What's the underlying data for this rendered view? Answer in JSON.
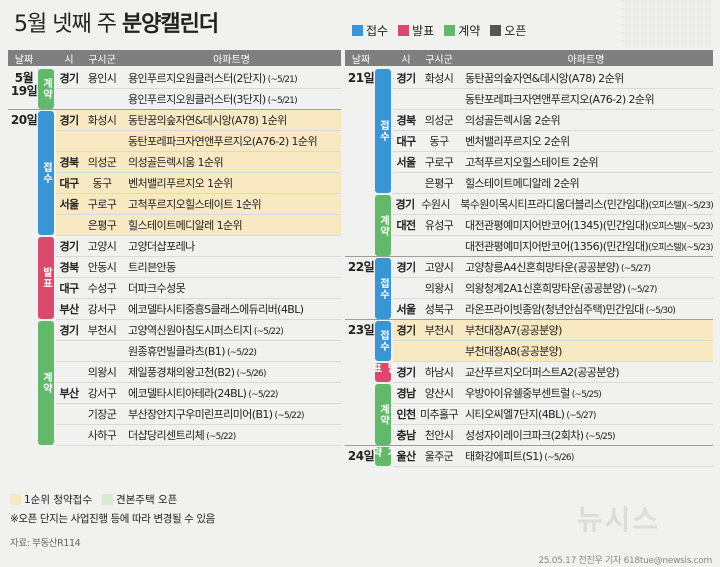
{
  "title": {
    "normal": "5월 넷째 주 ",
    "bold": "분양캘린더"
  },
  "legend": [
    {
      "label": "접수",
      "color": "#3a95d4"
    },
    {
      "label": "발표",
      "color": "#d94a6c"
    },
    {
      "label": "계약",
      "color": "#63b96b"
    },
    {
      "label": "오픈",
      "color": "#555555"
    }
  ],
  "headers": {
    "date": "날짜",
    "prov": "시",
    "city": "구시군",
    "apt": "아파트명"
  },
  "left_rows": [
    {
      "prov": "경기",
      "city": "용인시",
      "apt": "용인푸르지오원클러스터(2단지)",
      "note": " (~5/21)"
    },
    {
      "prov": "",
      "city": "",
      "apt": "용인푸르지오원클러스터(3단지)",
      "note": " (~5/21)"
    },
    {
      "prov": "경기",
      "city": "화성시",
      "apt": "동탄꿈의숲자연&데시앙(A78) 1순위",
      "note": ""
    },
    {
      "prov": "",
      "city": "",
      "apt": "동탄포레파크자연앤푸르지오(A76-2) 1순위",
      "note": ""
    },
    {
      "prov": "경북",
      "city": "의성군",
      "apt": "의성골든렉시움 1순위",
      "note": ""
    },
    {
      "prov": "대구",
      "city": "동구",
      "apt": "벤처밸리푸르지오 1순위",
      "note": ""
    },
    {
      "prov": "서울",
      "city": "구로구",
      "apt": "고척푸르지오힐스테이트 1순위",
      "note": ""
    },
    {
      "prov": "",
      "city": "은평구",
      "apt": "힐스테이트메디알레 1순위",
      "note": ""
    },
    {
      "prov": "경기",
      "city": "고양시",
      "apt": "고양더샵포레나",
      "note": ""
    },
    {
      "prov": "경북",
      "city": "안동시",
      "apt": "트리븐안동",
      "note": ""
    },
    {
      "prov": "대구",
      "city": "수성구",
      "apt": "더파크수성못",
      "note": ""
    },
    {
      "prov": "부산",
      "city": "강서구",
      "apt": "에코델타시티중흥S클래스에듀리버(4BL)",
      "note": ""
    },
    {
      "prov": "경기",
      "city": "부천시",
      "apt": "고양역신원아침도시퍼스티지",
      "note": " (~5/22)"
    },
    {
      "prov": "",
      "city": "",
      "apt": "원종휴먼빌클라츠(B1)",
      "note": " (~5/22)"
    },
    {
      "prov": "",
      "city": "의왕시",
      "apt": "제일풍경채의왕고천(B2)",
      "note": " (~5/26)"
    },
    {
      "prov": "부산",
      "city": "강서구",
      "apt": "에코델타시티아테라(24BL)",
      "note": " (~5/22)"
    },
    {
      "prov": "",
      "city": "기장군",
      "apt": "부산장안지구우미린프리미어(B1)",
      "note": " (~5/22)"
    },
    {
      "prov": "",
      "city": "사하구",
      "apt": "더샵당리센트리체",
      "note": " (~5/22)"
    }
  ],
  "left_dates": [
    {
      "label": "5월\n19일"
    },
    {
      "label": "20일"
    }
  ],
  "left_cats": [
    {
      "label": "계약"
    },
    {
      "label": "접수"
    },
    {
      "label": "발표"
    },
    {
      "label": "계약"
    }
  ],
  "right_rows": [
    {
      "prov": "경기",
      "city": "화성시",
      "apt": "동탄꿈의숲자연&데시앙(A78) 2순위",
      "note": ""
    },
    {
      "prov": "",
      "city": "",
      "apt": "동탄포레파크자연앤푸르지오(A76-2) 2순위",
      "note": ""
    },
    {
      "prov": "경북",
      "city": "의성군",
      "apt": "의성골든렉시움 2순위",
      "note": ""
    },
    {
      "prov": "대구",
      "city": "동구",
      "apt": "벤처밸리푸르지오 2순위",
      "note": ""
    },
    {
      "prov": "서울",
      "city": "구로구",
      "apt": "고척푸르지오힐스테이트 2순위",
      "note": ""
    },
    {
      "prov": "",
      "city": "은평구",
      "apt": "힐스테이트메디알레 2순위",
      "note": ""
    },
    {
      "prov": "경기",
      "city": "수원시",
      "apt": "북수원이목시티프라디움더블리스(민간임대)",
      "note": "(오피스텔)(~5/23)"
    },
    {
      "prov": "대전",
      "city": "유성구",
      "apt": "대전관평예미지어반코어(1345)(민간임대)",
      "note": "(오피스텔)(~5/23)"
    },
    {
      "prov": "",
      "city": "",
      "apt": "대전관평예미지어반코어(1356)(민간임대)",
      "note": "(오피스텔)(~5/23)"
    },
    {
      "prov": "경기",
      "city": "고양시",
      "apt": "고양창릉A4신혼희망타운(공공분양)",
      "note": " (~5/27)"
    },
    {
      "prov": "",
      "city": "의왕시",
      "apt": "의왕청계2A1신혼희망타운(공공분양)",
      "note": " (~5/27)"
    },
    {
      "prov": "서울",
      "city": "성북구",
      "apt": "라온프라이빗종암(청년안심주택)민간임대",
      "note": " (~5/30)"
    },
    {
      "prov": "경기",
      "city": "부천시",
      "apt": "부천대장A7(공공분양)",
      "note": ""
    },
    {
      "prov": "",
      "city": "",
      "apt": "부천대장A8(공공분양)",
      "note": ""
    },
    {
      "prov": "경기",
      "city": "하남시",
      "apt": "교산푸르지오더퍼스트A2(공공분양)",
      "note": ""
    },
    {
      "prov": "경남",
      "city": "양산시",
      "apt": "우방아이유쉘중부센트럴",
      "note": " (~5/25)"
    },
    {
      "prov": "인천",
      "city": "미추홀구",
      "apt": "시티오씨엘7단지(4BL)",
      "note": " (~5/27)"
    },
    {
      "prov": "충남",
      "city": "천안시",
      "apt": "성성자이레이크파크(2회차)",
      "note": " (~5/25)"
    },
    {
      "prov": "울산",
      "city": "울주군",
      "apt": "태화강에피트(S1)",
      "note": " (~5/26)"
    }
  ],
  "right_dates": [
    {
      "label": "21일"
    },
    {
      "label": "22일"
    },
    {
      "label": "23일"
    },
    {
      "label": "24일"
    }
  ],
  "right_cats": [
    {
      "label": "접수"
    },
    {
      "label": "계약"
    },
    {
      "label": "접수"
    },
    {
      "label": "접수"
    },
    {
      "label": "발표"
    },
    {
      "label": "계약"
    },
    {
      "label": "계약"
    }
  ],
  "footer": {
    "legend_yellow": "1순위 청약접수",
    "legend_green": "견본주택 오픈",
    "note": "※오픈 단지는 사업진행 등에 따라 변경될 수 있음",
    "source": "자료: 부동산R114",
    "watermark": "뉴시스",
    "credit": "25.05.17 전진우 기자 618tue@newsis.com"
  }
}
